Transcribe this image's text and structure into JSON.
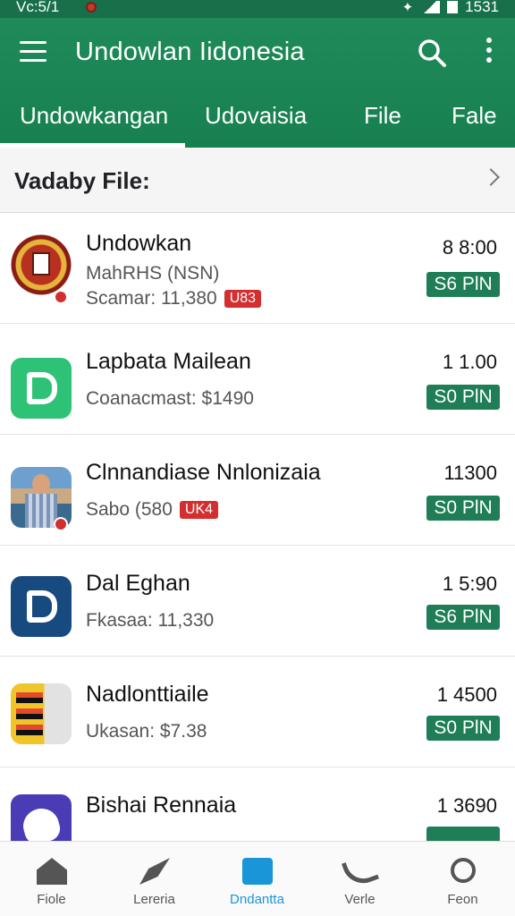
{
  "status": {
    "time": "Vc:5/1",
    "clock": "1531"
  },
  "app_bar": {
    "title": "Undowlan Iidonesia"
  },
  "tabs": [
    {
      "label": "Undowkangan",
      "active": true
    },
    {
      "label": "Udovaisia"
    },
    {
      "label": "File"
    },
    {
      "label": "Fale"
    }
  ],
  "section": {
    "title": "Vadaby File:"
  },
  "items": [
    {
      "title": "Undowkan",
      "subtitle": "MahRHS (NSN)",
      "meta": "Scamar: 11,380",
      "tag": "U83",
      "time": "8 8:00",
      "badge": "S6 PlN",
      "icon": "seal-emblem-icon"
    },
    {
      "title": "Lapbata Mailean",
      "meta": "Coanacmast: $1490",
      "time": "1 1.00",
      "badge": "S0 PlN",
      "icon": "green-app-icon"
    },
    {
      "title": "Clnnandiase Nnlonizaia",
      "meta": "Sabo (580",
      "tag": "UK4",
      "time": "11300",
      "badge": "S0 PlN",
      "icon": "person-photo-icon"
    },
    {
      "title": "Dal Eghan",
      "meta": "Fkasaa: 11,330",
      "time": "1 5:90",
      "badge": "S6 PlN",
      "icon": "blue-app-icon"
    },
    {
      "title": "Nadlonttiaile",
      "meta": "Ukasan: $7.38",
      "time": "1 4500",
      "badge": "S0 PlN",
      "icon": "poster-icon"
    },
    {
      "title": "Bishai Rennaia",
      "meta": "",
      "time": "1 3690",
      "badge": "",
      "icon": "purple-app-icon"
    }
  ],
  "bottom_nav": [
    {
      "label": "Fiole",
      "icon": "home-icon"
    },
    {
      "label": "Lereria",
      "icon": "rocket-icon"
    },
    {
      "label": "Dndantta",
      "icon": "shopping-bag-icon",
      "active": true
    },
    {
      "label": "Verle",
      "icon": "phone-icon"
    },
    {
      "label": "Feon",
      "icon": "search-icon"
    }
  ],
  "colors": {
    "primary": "#1f8a5a",
    "badge": "#1f7e55",
    "tag": "#d32f2f",
    "nav_active": "#1a95d8"
  }
}
